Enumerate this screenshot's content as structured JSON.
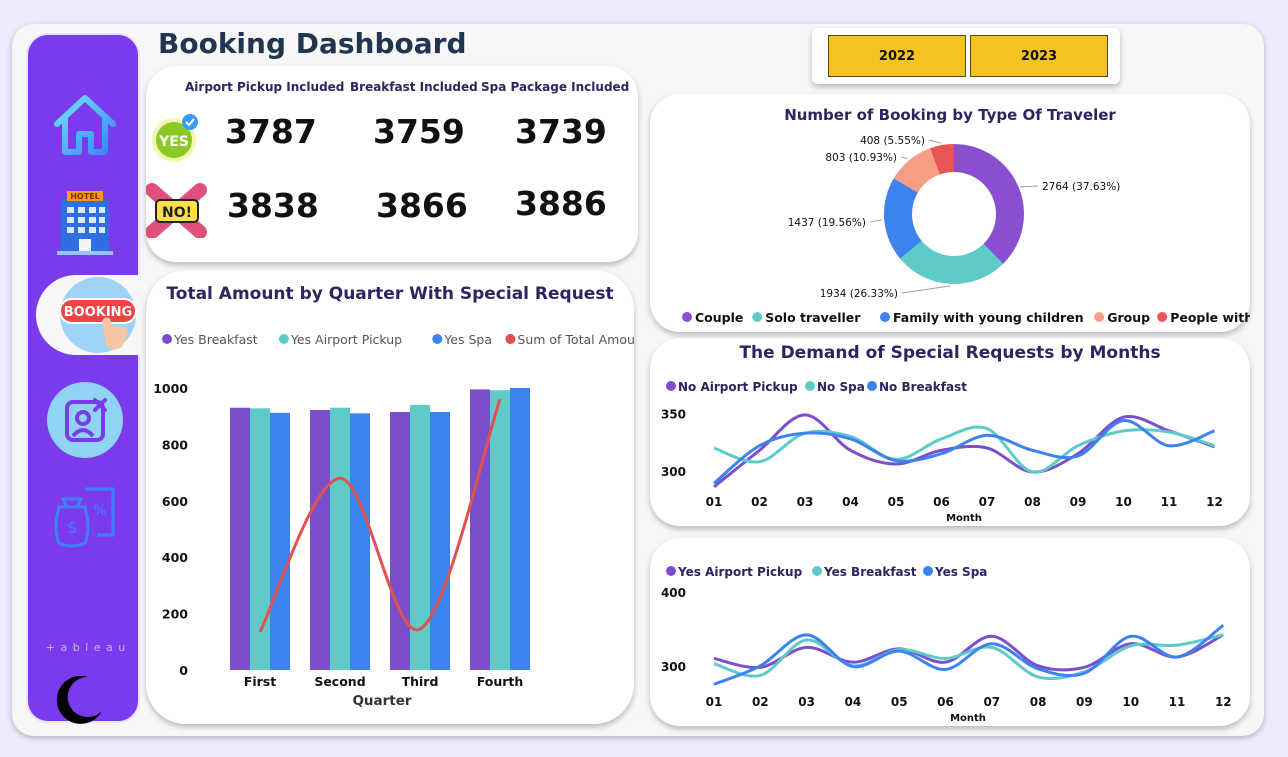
{
  "page": {
    "title": "Booking Dashboard",
    "year_filters": [
      "2022",
      "2023"
    ]
  },
  "sidebar": {
    "items": [
      {
        "name": "home-icon"
      },
      {
        "name": "hotel-icon"
      },
      {
        "name": "booking-icon",
        "label": "BOOKING",
        "active": true
      },
      {
        "name": "cancel-user-icon"
      },
      {
        "name": "money-receipt-icon"
      }
    ],
    "brand": "+ a b l e a u",
    "theme_icon": "moon-icon"
  },
  "kpis": {
    "headers": [
      "Airport Pickup Included",
      "Breakfast Included",
      "Spa Package Included"
    ],
    "yes_badge": "YES",
    "no_badge": "NO!",
    "yes_values": [
      "3787",
      "3759",
      "3739"
    ],
    "no_values": [
      "3838",
      "3866",
      "3886"
    ]
  },
  "donut": {
    "title": "Number of Booking by Type Of Traveler",
    "colors": [
      "#8a4fd0",
      "#5ecbc8",
      "#3d83f0",
      "#f59e85",
      "#ea5455"
    ],
    "chart_data": {
      "type": "pie",
      "categories": [
        "Couple",
        "Solo traveller",
        "Family with young children",
        "Group",
        "People with friends"
      ],
      "values": [
        2764,
        1934,
        1437,
        803,
        408
      ],
      "labels": [
        "2764 (37.63%)",
        "1934 (26.33%)",
        "1437 (19.56%)",
        "803 (10.93%)",
        "408 (5.55%)"
      ]
    }
  },
  "quarter": {
    "title": "Total Amount by Quarter With Special Request",
    "legend": [
      "Yes Breakfast",
      "Yes Airport Pickup",
      "Yes Spa",
      "Sum of Total Amount"
    ],
    "colors": [
      "#7b4fcc",
      "#5ecbc8",
      "#3d83f0",
      "#e0504f"
    ],
    "chart_data": {
      "type": "bar",
      "categories": [
        "First",
        "Second",
        "Third",
        "Fourth"
      ],
      "xlabel": "Quarter",
      "ylim": [
        0,
        1000
      ],
      "yticks": [
        0,
        200,
        400,
        600,
        800,
        1000
      ],
      "series": [
        {
          "name": "Yes Breakfast",
          "values": [
            930,
            922,
            915,
            995
          ]
        },
        {
          "name": "Yes Airport Pickup",
          "values": [
            928,
            930,
            940,
            992
          ]
        },
        {
          "name": "Yes Spa",
          "values": [
            912,
            910,
            915,
            1000
          ]
        }
      ],
      "line": {
        "name": "Sum of Total Amount",
        "values": [
          135,
          680,
          145,
          960
        ]
      }
    }
  },
  "demand_no": {
    "title": "The Demand of Special Requests by Months",
    "legend": [
      "No Airport Pickup",
      "No Spa",
      "No Breakfast"
    ],
    "colors": [
      "#7b4fcc",
      "#5ecbc8",
      "#3d83f0"
    ],
    "chart_data": {
      "type": "line",
      "x": [
        "01",
        "02",
        "03",
        "04",
        "05",
        "06",
        "07",
        "08",
        "09",
        "10",
        "11",
        "12"
      ],
      "xlabel": "Month",
      "yticks": [
        300,
        350
      ],
      "ylim": [
        285,
        355
      ],
      "series": [
        {
          "name": "No Airport Pickup",
          "values": [
            286,
            318,
            349,
            318,
            306,
            318,
            320,
            299,
            315,
            347,
            335,
            321
          ]
        },
        {
          "name": "No Spa",
          "values": [
            320,
            308,
            333,
            330,
            310,
            328,
            337,
            299,
            322,
            335,
            334,
            322
          ]
        },
        {
          "name": "No Breakfast",
          "values": [
            289,
            322,
            333,
            328,
            309,
            315,
            331,
            318,
            313,
            344,
            322,
            335
          ]
        }
      ]
    }
  },
  "demand_yes": {
    "legend": [
      "Yes Airport Pickup",
      "Yes Breakfast",
      "Yes Spa"
    ],
    "colors": [
      "#7b4fcc",
      "#5ecbc8",
      "#3d83f0"
    ],
    "chart_data": {
      "type": "line",
      "x": [
        "01",
        "02",
        "03",
        "04",
        "05",
        "06",
        "07",
        "08",
        "09",
        "10",
        "11",
        "12"
      ],
      "xlabel": "Month",
      "yticks": [
        300,
        400
      ],
      "ylim": [
        270,
        400
      ],
      "series": [
        {
          "name": "Yes Airport Pickup",
          "values": [
            310,
            298,
            325,
            305,
            323,
            305,
            340,
            300,
            298,
            330,
            312,
            342
          ]
        },
        {
          "name": "Yes Breakfast",
          "values": [
            303,
            287,
            335,
            300,
            322,
            310,
            325,
            285,
            292,
            327,
            328,
            342
          ]
        },
        {
          "name": "Yes Spa",
          "values": [
            275,
            300,
            342,
            299,
            320,
            295,
            330,
            296,
            290,
            340,
            312,
            355
          ]
        }
      ]
    }
  }
}
